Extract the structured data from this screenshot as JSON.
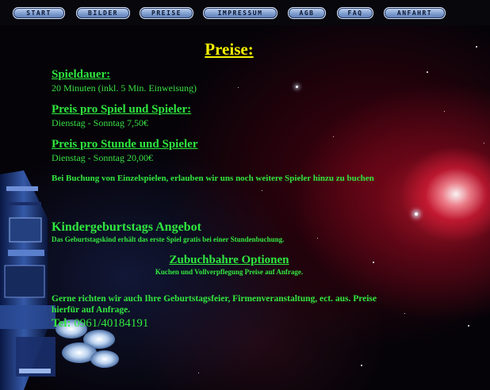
{
  "nav": [
    {
      "label": "START"
    },
    {
      "label": "BILDER"
    },
    {
      "label": "PREISE"
    },
    {
      "label": "IMPRESSUM"
    },
    {
      "label": "AGB"
    },
    {
      "label": "FAQ"
    },
    {
      "label": "ANFAHRT"
    }
  ],
  "page_title": "Preise:",
  "sections": {
    "spieldauer_heading": "Spieldauer:",
    "spieldauer_text": "20 Minuten (inkl. 5 Min. Einweisung)",
    "preis_spiel_heading": "Preis pro Spiel und Spieler:",
    "preis_spiel_text": "Dienstag - Sonntag 7,50€",
    "preis_stunde_heading": "Preis pro Stunde und Spieler",
    "preis_stunde_text": "Dienstag - Sonntag 20,00€",
    "einzelspiel_note": "Bei Buchung von Einzelspielen, erlauben wir uns noch weitere Spieler hinzu zu buchen"
  },
  "kinder": {
    "heading": "Kindergeburtstags Angebot",
    "text": "Das Geburtstagskind erhält das erste Spiel gratis bei einer Stundenbuchung."
  },
  "optionen": {
    "heading": "Zubuchbahre Optionen",
    "text": "Kuchen und Vollverpflegung Preise auf Anfrage."
  },
  "contact": {
    "text_line1": "Gerne richten wir auch Ihre Geburtstagsfeier, Firmenveranstaltung, ect. aus. Preise",
    "text_line2": "hierfür auf Anfrage.",
    "tel_label": "Tel:",
    "tel_number": "0961/40184191"
  }
}
